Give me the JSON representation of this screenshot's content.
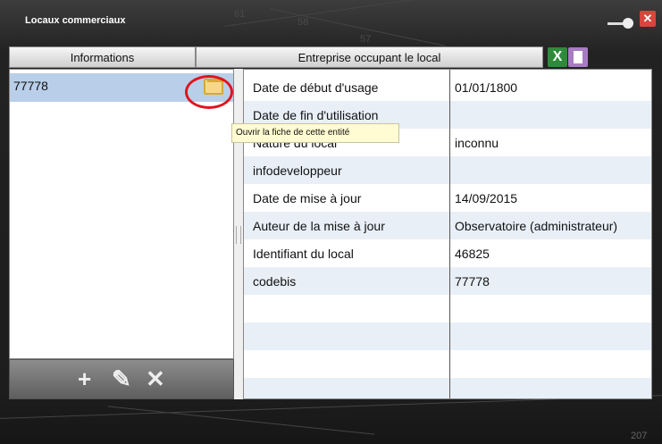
{
  "window": {
    "title": "Locaux commerciaux",
    "close_glyph": "✕",
    "map_labels": [
      "61",
      "58",
      "57"
    ],
    "corner_label": "207"
  },
  "tabs": {
    "informations": "Informations",
    "entreprise": "Entreprise occupant le local",
    "excel_glyph": "X"
  },
  "list": {
    "items": [
      {
        "label": "77778"
      }
    ]
  },
  "toolbar": {
    "add_glyph": "+",
    "edit_glyph": "✎",
    "delete_glyph": "✕"
  },
  "tooltip": "Ouvrir la fiche de cette entité",
  "details": {
    "rows": [
      {
        "key": "Date de début d'usage",
        "value": "01/01/1800"
      },
      {
        "key": "Date de fin d'utilisation",
        "value": ""
      },
      {
        "key": "Nature du local",
        "value": "inconnu"
      },
      {
        "key": "infodeveloppeur",
        "value": ""
      },
      {
        "key": "Date de mise à jour",
        "value": "14/09/2015"
      },
      {
        "key": "Auteur de la mise à jour",
        "value": "Observatoire (administrateur)"
      },
      {
        "key": "Identifiant du local",
        "value": "46825"
      },
      {
        "key": "codebis",
        "value": "77778"
      }
    ]
  },
  "colors": {
    "selected_row": "#b9cfe9",
    "highlight_circle": "#e0141e",
    "close_button": "#d9453d",
    "alt_row": "#e9eff7"
  },
  "icons": {
    "open_entity": "folder-icon",
    "excel_export": "excel-icon",
    "document": "document-icon"
  }
}
